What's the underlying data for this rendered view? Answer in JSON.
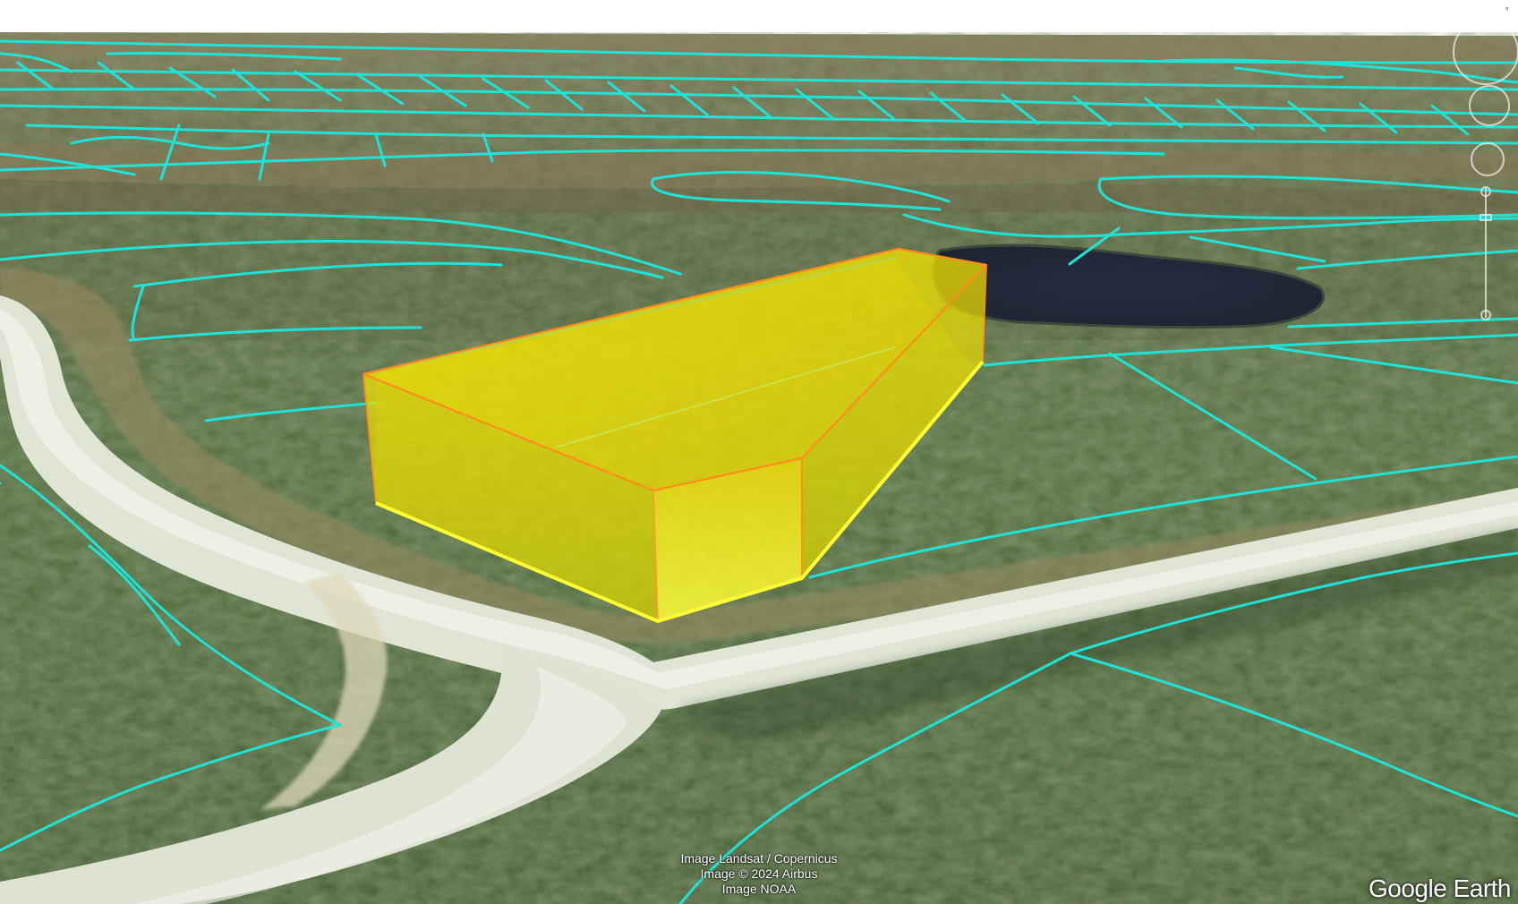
{
  "map": {
    "type": "3D satellite terrain view",
    "colors": {
      "sky": "#ffffff",
      "parcel_lines": "#1fe3d6",
      "highlight_fill": "#ffee00",
      "highlight_edge_top": "#ff8c1a",
      "highlight_edge_base": "#ffff33",
      "road": "#e4e9dc",
      "pond": "#232a3d",
      "forest": "#4f6b3a"
    },
    "features": {
      "highlighted_parcel": "3D extruded parcel outline",
      "pond": "pond",
      "road": "gravel road"
    }
  },
  "attribution": {
    "line1": "Image Landsat / Copernicus",
    "line2": "Image © 2024 Airbus",
    "line3": "Image NOAA"
  },
  "branding": {
    "logo_text": "Google Earth"
  },
  "controls": {
    "compass": "compass-icon",
    "look": "look-joystick-icon",
    "move": "move-joystick-icon",
    "zoom": "zoom-slider-icon"
  }
}
